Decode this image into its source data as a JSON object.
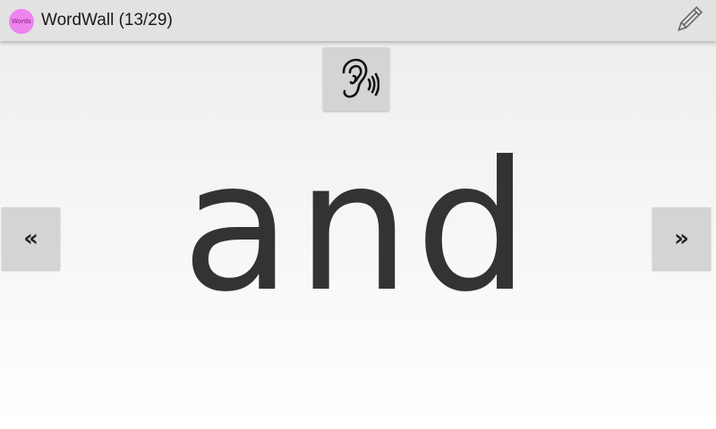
{
  "action_bar": {
    "app_icon_text": "Words",
    "title": "WordWall (13/29)",
    "edit_icon": "pencil-icon"
  },
  "listen_button": {
    "icon": "ear-sound-icon"
  },
  "navigation": {
    "prev_label": "«",
    "next_label": "»"
  },
  "flashcard": {
    "word": "and"
  },
  "colors": {
    "action_bar_bg": "#e2e2e2",
    "app_icon_bg": "#ee82ee",
    "button_bg": "#d4d4d4",
    "word_color": "#333333"
  }
}
